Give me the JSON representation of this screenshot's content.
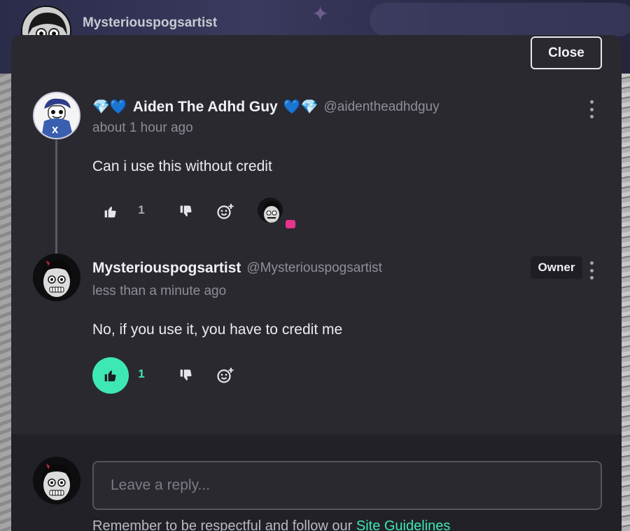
{
  "background": {
    "profile_name": "Mysteriouspogsartist"
  },
  "modal": {
    "close_label": "Close"
  },
  "comments": [
    {
      "author": "Aiden The Adhd Guy",
      "author_prefix_emoji": "💎💙",
      "author_suffix_emoji": "💙💎",
      "handle": "@aidentheadhdguy",
      "timestamp": "about 1 hour ago",
      "text": "Can i use this without credit",
      "likes": "1",
      "liked": false,
      "badge": ""
    },
    {
      "author": "Mysteriouspogsartist",
      "handle": "@Mysteriouspogsartist",
      "timestamp": "less than a minute ago",
      "text": "No, if you use it, you have to credit me",
      "likes": "1",
      "liked": true,
      "badge": "Owner"
    }
  ],
  "reply": {
    "placeholder": "Leave a reply...",
    "guidelines_prefix": "Remember to be respectful and follow our ",
    "guidelines_link": "Site Guidelines"
  },
  "colors": {
    "accent": "#3ee8b5",
    "modal_bg": "#2a2930",
    "reply_bg": "#222127",
    "reaction_indicator": "#e8338f"
  },
  "icons": {
    "like": "thumbs-up-icon",
    "dislike": "thumbs-down-icon",
    "react": "add-reaction-icon",
    "more": "more-vertical-icon"
  }
}
